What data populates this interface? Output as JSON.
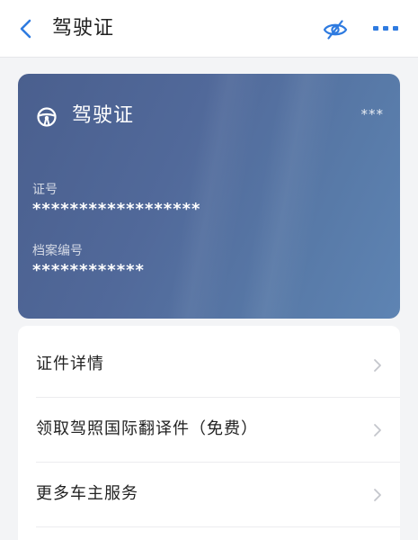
{
  "header": {
    "title": "驾驶证",
    "icons": {
      "back": "chevron-left-icon",
      "visibility": "eye-slash-icon",
      "more": "more-dots-icon"
    },
    "accent_color": "#2f7be0"
  },
  "card": {
    "icon": "steering-wheel-icon",
    "title": "驾驶证",
    "masked": "***",
    "license_number_label": "证号",
    "license_number_value": "******************",
    "file_number_label": "档案编号",
    "file_number_value": "************",
    "colors": {
      "gradient_start": "#4a5f8e",
      "gradient_end": "#5e84b3"
    }
  },
  "menu": {
    "items": [
      {
        "label": "证件详情"
      },
      {
        "label": "领取驾照国际翻译件（免费）"
      },
      {
        "label": "更多车主服务"
      }
    ],
    "chevron_icon": "chevron-right-icon"
  }
}
